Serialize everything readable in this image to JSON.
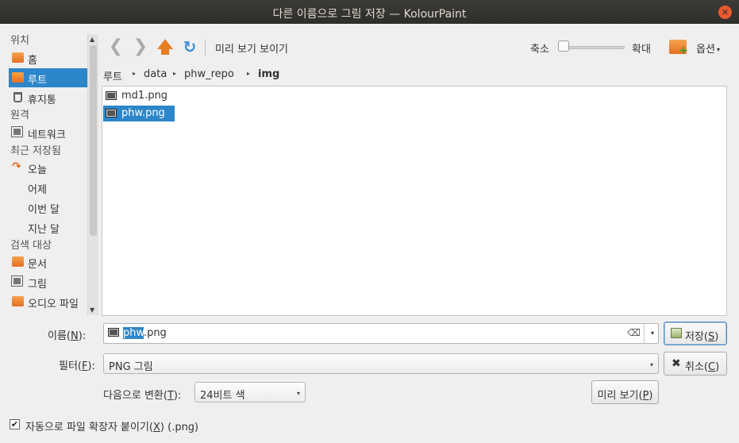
{
  "window": {
    "title": "다른 이름으로 그림 저장 — KolourPaint",
    "close_glyph": "✕"
  },
  "sidebar": {
    "sections": {
      "places": "위치",
      "remote": "원격",
      "recent": "최근 저장됨",
      "search": "검색 대상"
    },
    "items": {
      "home": "홈",
      "root": "루트",
      "trash": "휴지통",
      "network": "네트워크",
      "today": "오늘",
      "yesterday": "어제",
      "this_month": "이번 달",
      "last_month": "지난 달",
      "documents": "문서",
      "pictures": "그림",
      "audio": "오디오 파일"
    }
  },
  "toolbar": {
    "back_glyph": "❮",
    "forward_glyph": "❯",
    "up_glyph": "🡅",
    "reload_glyph": "↻",
    "preview_label": "미리 보기 보이기",
    "zoom_out_label": "축소",
    "zoom_in_label": "확대",
    "zoom_level": 0,
    "options_label": "옵션",
    "options_arrow": "▾"
  },
  "breadcrumb": {
    "parts": [
      "루트",
      "data",
      "phw_repo",
      "img"
    ],
    "separator": "▸"
  },
  "files": [
    {
      "name": "md1.png",
      "selected": false
    },
    {
      "name": "phw.png",
      "selected": true
    }
  ],
  "form": {
    "name_label_prefix": "이름(",
    "name_label_key": "N",
    "name_label_suffix": "):",
    "name_value_selected": "phw",
    "name_value_rest": ".png",
    "clear_glyph": "⌫",
    "filter_label_prefix": "필터(",
    "filter_label_key": "F",
    "filter_label_suffix": "):",
    "filter_value": "PNG 그림",
    "convert_label_prefix": "다음으로 변환(",
    "convert_label_key": "T",
    "convert_label_suffix": "):",
    "convert_value": "24비트 색",
    "dropdown_arrow": "▾",
    "save_prefix": "저장(",
    "save_key": "S",
    "save_suffix": ")",
    "cancel_prefix": "취소(",
    "cancel_key": "C",
    "cancel_suffix": ")",
    "preview_prefix": "미리 보기(",
    "preview_key": "P",
    "preview_suffix": ")",
    "auto_ext_prefix": "자동으로 파일 확장자 붙이기(",
    "auto_ext_key": "X",
    "auto_ext_suffix": ") (.png)",
    "auto_ext_checked_glyph": "✔"
  },
  "colors": {
    "accent": "#2d86c9",
    "titlebar": "#2e2d29",
    "close": "#e9592f"
  }
}
